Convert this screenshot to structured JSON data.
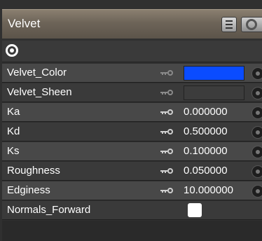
{
  "panel": {
    "title": "Velvet"
  },
  "properties": [
    {
      "label": "Velvet_Color",
      "type": "color",
      "color": "#0a4cff",
      "keyed": false
    },
    {
      "label": "Velvet_Sheen",
      "type": "color",
      "color": "#3c3c3c",
      "keyed": false
    },
    {
      "label": "Ka",
      "type": "number",
      "value": "0.000000",
      "keyed": true
    },
    {
      "label": "Kd",
      "type": "number",
      "value": "0.500000",
      "keyed": true
    },
    {
      "label": "Ks",
      "type": "number",
      "value": "0.100000",
      "keyed": true
    },
    {
      "label": "Roughness",
      "type": "number",
      "value": "0.050000",
      "keyed": true
    },
    {
      "label": "Edginess",
      "type": "number",
      "value": "10.000000",
      "keyed": true
    },
    {
      "label": "Normals_Forward",
      "type": "checkbox",
      "checked": false
    }
  ],
  "icons": {
    "header_target": "target-icon",
    "key_icon": "key-icon",
    "connector": "connector-icon"
  }
}
